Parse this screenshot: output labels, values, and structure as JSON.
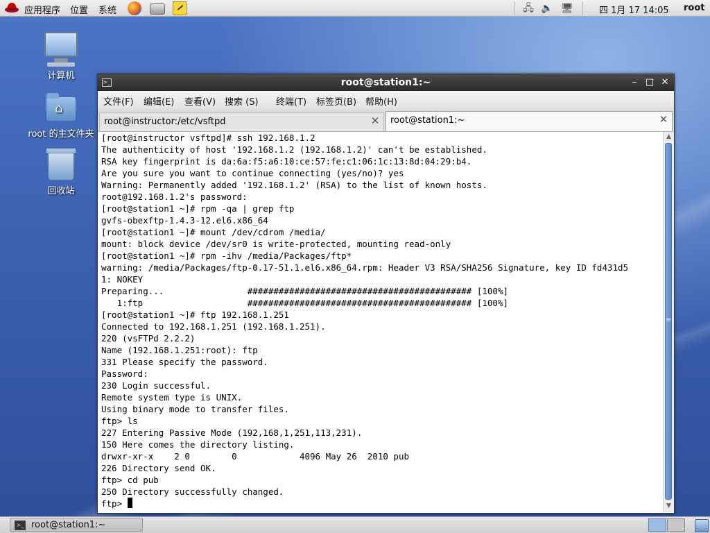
{
  "top_panel": {
    "menus": [
      "应用程序",
      "位置",
      "系统"
    ],
    "clock": "四 1月 17 14:05",
    "user": "root",
    "launchers": [
      "firefox-icon",
      "scanner-icon",
      "notes-icon"
    ],
    "tray": [
      "network-icon",
      "volume-icon",
      "display-icon"
    ]
  },
  "desktop": {
    "icons": [
      {
        "label": "计算机",
        "icon": "computer-icon"
      },
      {
        "label": "root 的主文件夹",
        "icon": "home-folder-icon"
      },
      {
        "label": "回收站",
        "icon": "trash-icon"
      }
    ]
  },
  "window": {
    "title": "root@station1:~",
    "menu": [
      "文件(F)",
      "编辑(E)",
      "查看(V)",
      "搜索 (S)",
      "终端(T)",
      "标签页(B)",
      "帮助(H)"
    ],
    "tabs": [
      {
        "label": "root@instructor:/etc/vsftpd",
        "active": false
      },
      {
        "label": "root@station1:~",
        "active": true
      }
    ],
    "terminal_lines": [
      "[root@instructor vsftpd]# ssh 192.168.1.2",
      "The authenticity of host '192.168.1.2 (192.168.1.2)' can't be established.",
      "RSA key fingerprint is da:6a:f5:a6:10:ce:57:fe:c1:06:1c:13:8d:04:29:b4.",
      "Are you sure you want to continue connecting (yes/no)? yes",
      "Warning: Permanently added '192.168.1.2' (RSA) to the list of known hosts.",
      "root@192.168.1.2's password:",
      "[root@station1 ~]# rpm -qa | grep ftp",
      "gvfs-obexftp-1.4.3-12.el6.x86_64",
      "[root@station1 ~]# mount /dev/cdrom /media/",
      "mount: block device /dev/sr0 is write-protected, mounting read-only",
      "[root@station1 ~]# rpm -ihv /media/Packages/ftp*",
      "warning: /media/Packages/ftp-0.17-51.1.el6.x86_64.rpm: Header V3 RSA/SHA256 Signature, key ID fd431d5",
      "1: NOKEY",
      "Preparing...                ########################################### [100%]",
      "   1:ftp                    ########################################### [100%]",
      "[root@station1 ~]# ftp 192.168.1.251",
      "Connected to 192.168.1.251 (192.168.1.251).",
      "220 (vsFTPd 2.2.2)",
      "Name (192.168.1.251:root): ftp",
      "331 Please specify the password.",
      "Password:",
      "230 Login successful.",
      "Remote system type is UNIX.",
      "Using binary mode to transfer files.",
      "ftp> ls",
      "227 Entering Passive Mode (192,168,1,251,113,231).",
      "150 Here comes the directory listing.",
      "drwxr-xr-x    2 0        0            4096 May 26  2010 pub",
      "226 Directory send OK.",
      "ftp> cd pub",
      "250 Directory successfully changed."
    ],
    "prompt": "ftp> "
  },
  "bottom_panel": {
    "task_label": "root@station1:~",
    "workspaces": 2
  }
}
